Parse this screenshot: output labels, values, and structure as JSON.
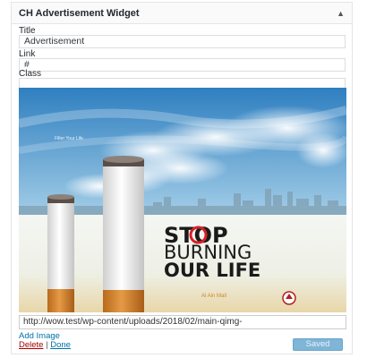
{
  "widget": {
    "title": "CH Advertisement Widget"
  },
  "fields": {
    "title_label": "Title",
    "title_value": "Advertisement",
    "link_label": "Link",
    "link_value": "#",
    "class_label": "Class",
    "class_value": ""
  },
  "ad": {
    "small_caption": "Filter Your Life",
    "headline_line1": "STOP",
    "headline_line2": "BURNING",
    "headline_line3": "OUR LIFE",
    "brand_text": "Al Ain Mall",
    "colors": {
      "sky_top": "#2f7fc0",
      "sky_bottom": "#cfe6f3",
      "headline": "#1a1a1a",
      "stop_o": "#d62027",
      "filter": "#d8892f"
    }
  },
  "image": {
    "url": "http://wow.test/wp-content/uploads/2018/02/main-qimg-",
    "add_image_label": "Add Image"
  },
  "actions": {
    "delete_label": "Delete",
    "separator": "|",
    "done_label": "Done",
    "saved_label": "Saved"
  }
}
